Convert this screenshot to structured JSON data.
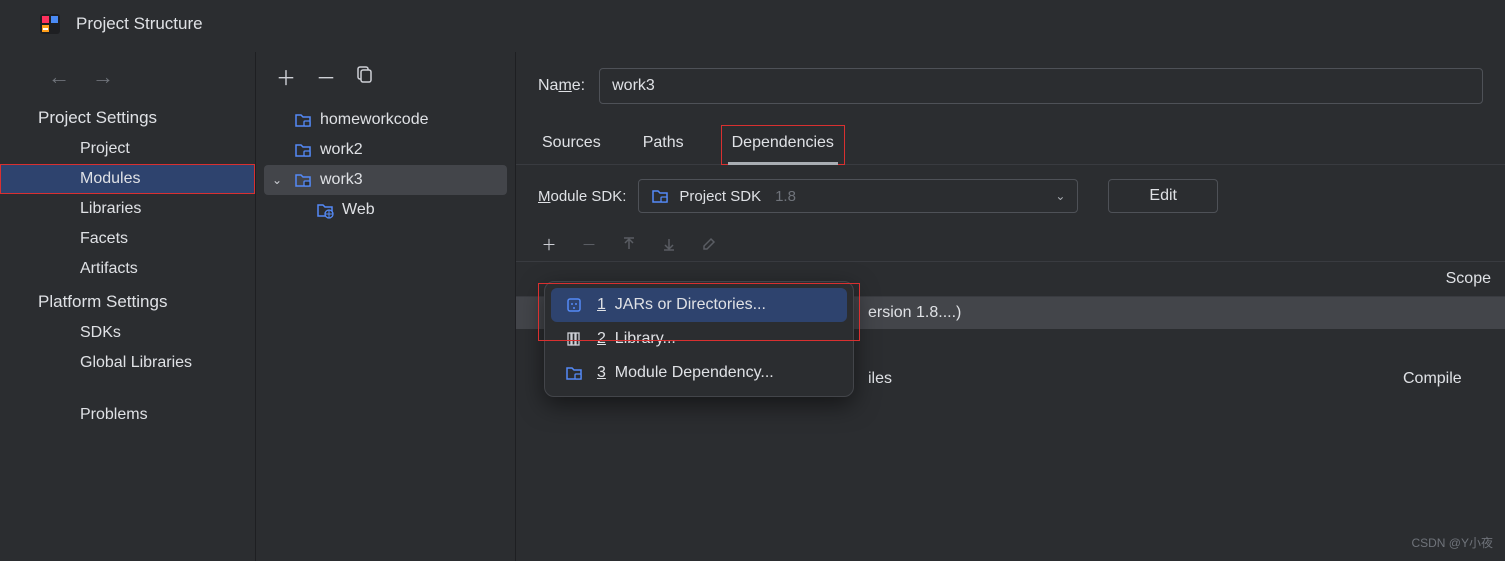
{
  "title": "Project Structure",
  "sidebar": {
    "sections": [
      {
        "title": "Project Settings",
        "items": [
          "Project",
          "Modules",
          "Libraries",
          "Facets",
          "Artifacts"
        ]
      },
      {
        "title": "Platform Settings",
        "items": [
          "SDKs",
          "Global Libraries"
        ]
      }
    ],
    "problems": "Problems"
  },
  "tree": {
    "items": [
      {
        "name": "homeworkcode",
        "level": 0,
        "expanded": false
      },
      {
        "name": "work2",
        "level": 0,
        "expanded": false
      },
      {
        "name": "work3",
        "level": 0,
        "expanded": true,
        "selected": true
      },
      {
        "name": "Web",
        "level": 1,
        "type": "web"
      }
    ]
  },
  "name_label": "Name:",
  "name_value": "work3",
  "tabs": [
    "Sources",
    "Paths",
    "Dependencies"
  ],
  "active_tab": "Dependencies",
  "sdk": {
    "label": "Module SDK:",
    "selected": "Project SDK",
    "version": "1.8",
    "edit": "Edit"
  },
  "dep_header": {
    "scope": "Scope"
  },
  "deps": [
    {
      "text_visible": "ersion 1.8....)",
      "scope": "",
      "selected": true
    },
    {
      "text_visible": "iles",
      "scope": "Compile",
      "selected": false
    }
  ],
  "popup": [
    {
      "num": "1",
      "label": "JARs or Directories...",
      "icon": "jar",
      "selected": true
    },
    {
      "num": "2",
      "label": "Library...",
      "icon": "lib",
      "selected": false
    },
    {
      "num": "3",
      "label": "Module Dependency...",
      "icon": "mod",
      "selected": false
    }
  ],
  "watermark": "CSDN @Y小夜"
}
